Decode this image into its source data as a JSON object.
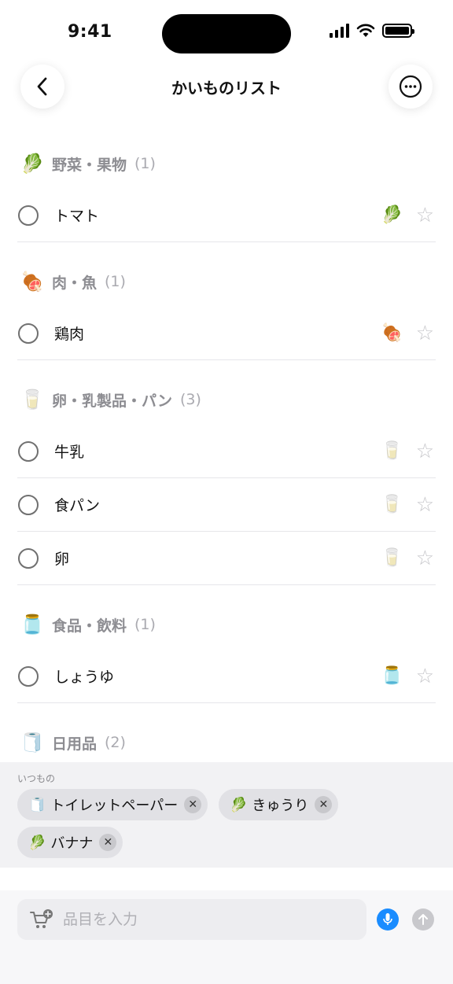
{
  "status_bar": {
    "time": "9:41"
  },
  "nav": {
    "title": "かいものリスト"
  },
  "sections": [
    {
      "emoji": "🥬",
      "name": "野菜・果物",
      "count": "(1)",
      "items": [
        {
          "name": "トマト",
          "emoji": "🥬"
        }
      ]
    },
    {
      "emoji": "🍖",
      "name": "肉・魚",
      "count": "(1)",
      "items": [
        {
          "name": "鶏肉",
          "emoji": "🍖"
        }
      ]
    },
    {
      "emoji": "🥛",
      "name": "卵・乳製品・パン",
      "count": "(3)",
      "items": [
        {
          "name": "牛乳",
          "emoji": "🥛"
        },
        {
          "name": "食パン",
          "emoji": "🥛"
        },
        {
          "name": "卵",
          "emoji": "🥛"
        }
      ]
    },
    {
      "emoji": "🫙",
      "name": "食品・飲料",
      "count": "(1)",
      "items": [
        {
          "name": "しょうゆ",
          "emoji": "🫙"
        }
      ]
    },
    {
      "emoji": "🧻",
      "name": "日用品",
      "count": "(2)",
      "items": []
    }
  ],
  "suggestions": {
    "label": "いつもの",
    "chips": [
      {
        "emoji": "🧻",
        "label": "トイレットペーパー"
      },
      {
        "emoji": "🥬",
        "label": "きゅうり"
      },
      {
        "emoji": "🥬",
        "label": "バナナ"
      }
    ],
    "remove_symbol": "✕"
  },
  "input": {
    "placeholder": "品目を入力"
  },
  "icons": {
    "star": "☆",
    "back": "chevron-left-icon",
    "more": "ellipsis-circle-icon",
    "cart_add": "cart-plus-icon",
    "mic": "mic-icon",
    "send": "arrow-up-icon"
  },
  "colors": {
    "accent": "#1a8cff",
    "header_text": "#8d8d92"
  }
}
